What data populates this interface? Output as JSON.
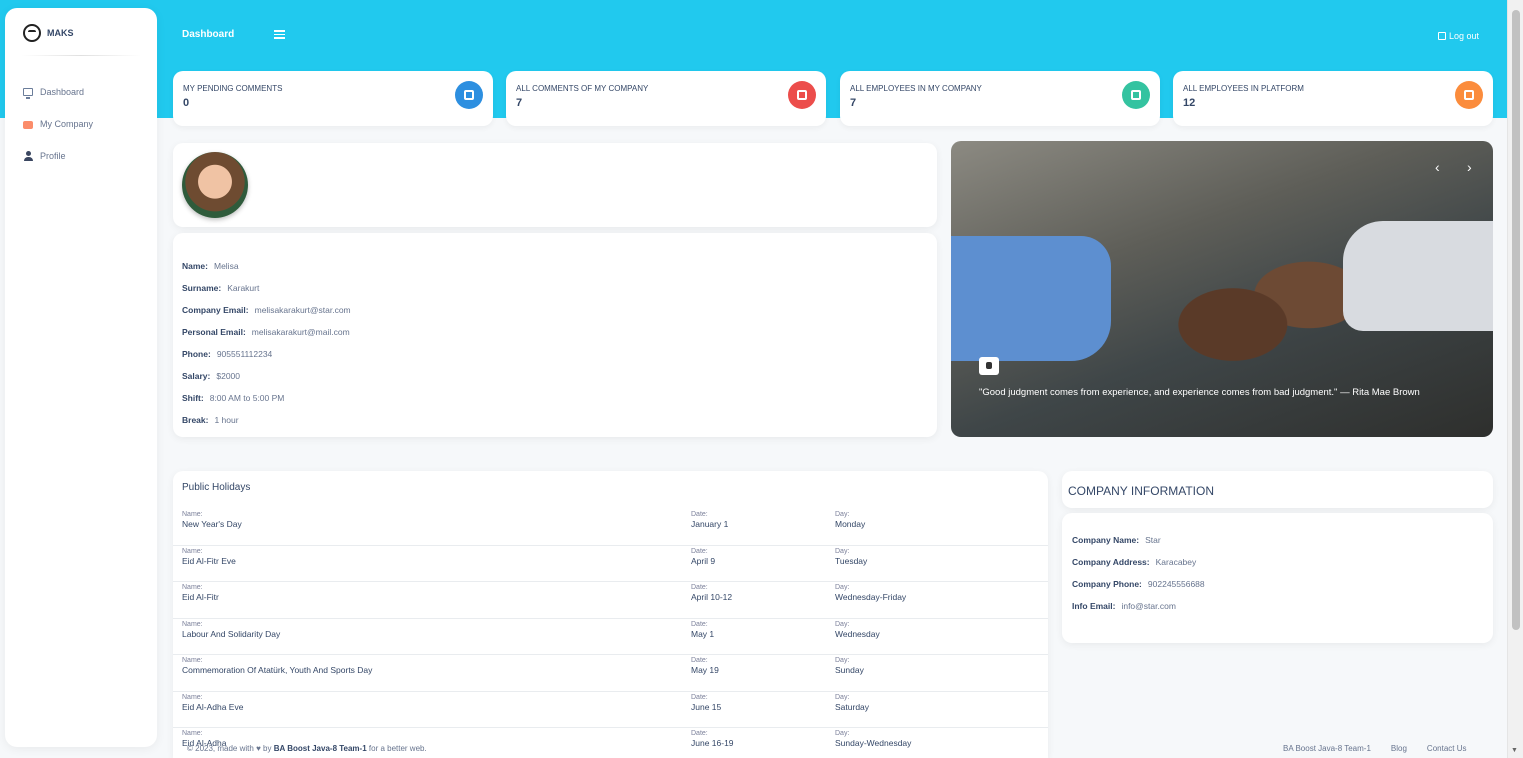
{
  "sidebar": {
    "brand": "MAKS",
    "items": [
      {
        "label": "Dashboard",
        "icon": "monitor-icon"
      },
      {
        "label": "My Company",
        "icon": "company-icon"
      },
      {
        "label": "Profile",
        "icon": "user-icon"
      }
    ]
  },
  "header": {
    "title": "Dashboard",
    "logout": "Log out"
  },
  "stats": [
    {
      "label": "MY PENDING COMMENTS",
      "value": "0",
      "color": "#2d8fe0",
      "icon": "comment-icon"
    },
    {
      "label": "ALL COMMENTS OF MY COMPANY",
      "value": "7",
      "color": "#ec4d4b",
      "icon": "folder-icon"
    },
    {
      "label": "ALL EMPLOYEES IN MY COMPANY",
      "value": "7",
      "color": "#34c3a0",
      "icon": "building-icon"
    },
    {
      "label": "ALL EMPLOYEES IN PLATFORM",
      "value": "12",
      "color": "#fb8c3c",
      "icon": "globe-icon"
    }
  ],
  "profile": {
    "rows": [
      {
        "key": "Name:",
        "value": "Melisa"
      },
      {
        "key": "Surname:",
        "value": "Karakurt"
      },
      {
        "key": "Company Email:",
        "value": "melisakarakurt@star.com"
      },
      {
        "key": "Personal Email:",
        "value": "melisakarakurt@mail.com"
      },
      {
        "key": "Phone:",
        "value": "905551112234"
      },
      {
        "key": "Salary:",
        "value": "$2000"
      },
      {
        "key": "Shift:",
        "value": "8:00 AM to 5:00 PM"
      },
      {
        "key": "Break:",
        "value": "1 hour"
      }
    ]
  },
  "carousel": {
    "quote": "\"Good judgment comes from experience, and experience comes from bad judgment.\" — Rita Mae Brown",
    "prev": "‹",
    "next": "›"
  },
  "holidays": {
    "title": "Public Holidays",
    "col_labels": {
      "name": "Name:",
      "date": "Date:",
      "day": "Day:"
    },
    "rows": [
      {
        "name": "New Year's Day",
        "date": "January 1",
        "day": "Monday"
      },
      {
        "name": "Eid Al-Fitr Eve",
        "date": "April 9",
        "day": "Tuesday"
      },
      {
        "name": "Eid Al-Fitr",
        "date": "April 10-12",
        "day": "Wednesday-Friday"
      },
      {
        "name": "Labour And Solidarity Day",
        "date": "May 1",
        "day": "Wednesday"
      },
      {
        "name": "Commemoration Of Atatürk, Youth And Sports Day",
        "date": "May 19",
        "day": "Sunday"
      },
      {
        "name": "Eid Al-Adha Eve",
        "date": "June 15",
        "day": "Saturday"
      },
      {
        "name": "Eid Al-Adha",
        "date": "June 16-19",
        "day": "Sunday-Wednesday"
      }
    ]
  },
  "company": {
    "title": "COMPANY INFORMATION",
    "rows": [
      {
        "key": "Company Name:",
        "value": "Star"
      },
      {
        "key": "Company Address:",
        "value": "Karacabey"
      },
      {
        "key": "Company Phone:",
        "value": "902245556688"
      },
      {
        "key": "Info Email:",
        "value": "info@star.com"
      }
    ]
  },
  "footer": {
    "prefix": "© 2023, made with",
    "by": "by",
    "team": "BA Boost Java-8 Team-1",
    "suffix": "for a better web.",
    "links": [
      "BA Boost Java-8 Team-1",
      "Blog",
      "Contact Us"
    ]
  }
}
